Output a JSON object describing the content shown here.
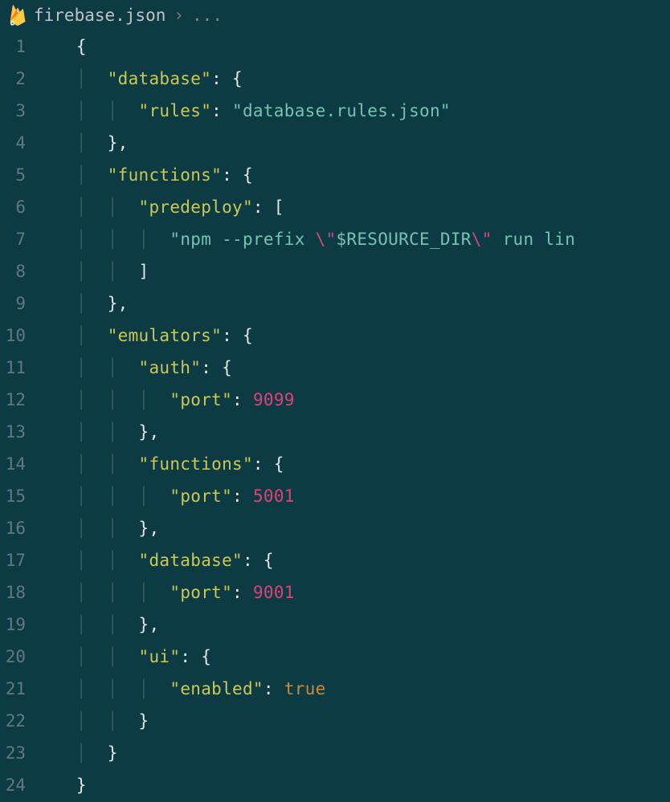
{
  "breadcrumb": {
    "file": "firebase.json",
    "separator": "›",
    "ellipsis": "..."
  },
  "lines": [
    {
      "num": 1,
      "indent": 1,
      "tokens": [
        {
          "t": "brace",
          "v": "{"
        }
      ]
    },
    {
      "num": 2,
      "indent": 2,
      "tokens": [
        {
          "t": "key-yellow",
          "v": "\"database\""
        },
        {
          "t": "colon",
          "v": ": "
        },
        {
          "t": "brace",
          "v": "{"
        }
      ]
    },
    {
      "num": 3,
      "indent": 3,
      "tokens": [
        {
          "t": "key-yellow",
          "v": "\"rules\""
        },
        {
          "t": "colon",
          "v": ": "
        },
        {
          "t": "string",
          "v": "\"database.rules.json\""
        }
      ]
    },
    {
      "num": 4,
      "indent": 2,
      "tokens": [
        {
          "t": "brace",
          "v": "}"
        },
        {
          "t": "comma",
          "v": ","
        }
      ]
    },
    {
      "num": 5,
      "indent": 2,
      "tokens": [
        {
          "t": "key-yellow",
          "v": "\"functions\""
        },
        {
          "t": "colon",
          "v": ": "
        },
        {
          "t": "brace",
          "v": "{"
        }
      ]
    },
    {
      "num": 6,
      "indent": 3,
      "tokens": [
        {
          "t": "key-yellow",
          "v": "\"predeploy\""
        },
        {
          "t": "colon",
          "v": ": "
        },
        {
          "t": "bracket",
          "v": "["
        }
      ]
    },
    {
      "num": 7,
      "indent": 4,
      "tokens": [
        {
          "t": "string",
          "v": "\"npm --prefix "
        },
        {
          "t": "escape",
          "v": "\\\""
        },
        {
          "t": "string",
          "v": "$RESOURCE_DIR"
        },
        {
          "t": "escape",
          "v": "\\\""
        },
        {
          "t": "string",
          "v": " run lin"
        }
      ]
    },
    {
      "num": 8,
      "indent": 3,
      "tokens": [
        {
          "t": "bracket",
          "v": "]"
        }
      ]
    },
    {
      "num": 9,
      "indent": 2,
      "tokens": [
        {
          "t": "brace",
          "v": "}"
        },
        {
          "t": "comma",
          "v": ","
        }
      ]
    },
    {
      "num": 10,
      "indent": 2,
      "tokens": [
        {
          "t": "key-yellow",
          "v": "\"emulators\""
        },
        {
          "t": "colon",
          "v": ": "
        },
        {
          "t": "brace",
          "v": "{"
        }
      ]
    },
    {
      "num": 11,
      "indent": 3,
      "tokens": [
        {
          "t": "key-yellow",
          "v": "\"auth\""
        },
        {
          "t": "colon",
          "v": ": "
        },
        {
          "t": "brace",
          "v": "{"
        }
      ]
    },
    {
      "num": 12,
      "indent": 4,
      "tokens": [
        {
          "t": "key-yellow",
          "v": "\"port\""
        },
        {
          "t": "colon",
          "v": ": "
        },
        {
          "t": "number",
          "v": "9099"
        }
      ]
    },
    {
      "num": 13,
      "indent": 3,
      "tokens": [
        {
          "t": "brace",
          "v": "}"
        },
        {
          "t": "comma",
          "v": ","
        }
      ]
    },
    {
      "num": 14,
      "indent": 3,
      "tokens": [
        {
          "t": "key-yellow",
          "v": "\"functions\""
        },
        {
          "t": "colon",
          "v": ": "
        },
        {
          "t": "brace",
          "v": "{"
        }
      ]
    },
    {
      "num": 15,
      "indent": 4,
      "tokens": [
        {
          "t": "key-yellow",
          "v": "\"port\""
        },
        {
          "t": "colon",
          "v": ": "
        },
        {
          "t": "number",
          "v": "5001"
        }
      ]
    },
    {
      "num": 16,
      "indent": 3,
      "tokens": [
        {
          "t": "brace",
          "v": "}"
        },
        {
          "t": "comma",
          "v": ","
        }
      ]
    },
    {
      "num": 17,
      "indent": 3,
      "tokens": [
        {
          "t": "key-yellow",
          "v": "\"database\""
        },
        {
          "t": "colon",
          "v": ": "
        },
        {
          "t": "brace",
          "v": "{"
        }
      ]
    },
    {
      "num": 18,
      "indent": 4,
      "tokens": [
        {
          "t": "key-yellow",
          "v": "\"port\""
        },
        {
          "t": "colon",
          "v": ": "
        },
        {
          "t": "number",
          "v": "9001"
        }
      ]
    },
    {
      "num": 19,
      "indent": 3,
      "tokens": [
        {
          "t": "brace",
          "v": "}"
        },
        {
          "t": "comma",
          "v": ","
        }
      ]
    },
    {
      "num": 20,
      "indent": 3,
      "tokens": [
        {
          "t": "key-yellow",
          "v": "\"ui\""
        },
        {
          "t": "colon",
          "v": ": "
        },
        {
          "t": "brace",
          "v": "{"
        }
      ]
    },
    {
      "num": 21,
      "indent": 4,
      "tokens": [
        {
          "t": "key-yellow",
          "v": "\"enabled\""
        },
        {
          "t": "colon",
          "v": ": "
        },
        {
          "t": "bool",
          "v": "true"
        }
      ]
    },
    {
      "num": 22,
      "indent": 3,
      "tokens": [
        {
          "t": "brace",
          "v": "}"
        }
      ]
    },
    {
      "num": 23,
      "indent": 2,
      "tokens": [
        {
          "t": "brace",
          "v": "}"
        }
      ]
    },
    {
      "num": 24,
      "indent": 1,
      "tokens": [
        {
          "t": "brace",
          "v": "}"
        }
      ]
    }
  ]
}
